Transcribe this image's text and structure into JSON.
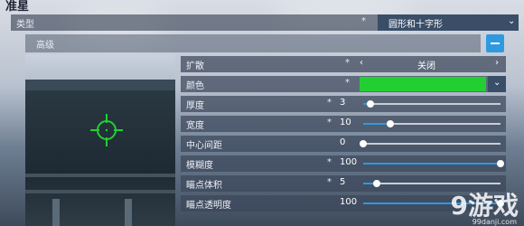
{
  "page": {
    "title": "准星"
  },
  "type_row": {
    "label": "类型",
    "star": "*",
    "value": "圆形和十字形"
  },
  "advanced": {
    "label": "高级",
    "toggle_icon": "minus-icon",
    "accent": "#2d9ae0"
  },
  "crosshair_color": "#22cf33",
  "settings": {
    "expand": {
      "label": "扩散",
      "star": "*",
      "value": "关闭"
    },
    "color": {
      "label": "颜色",
      "star": "*",
      "swatch": "#22cf33"
    },
    "thickness": {
      "label": "厚度",
      "star": "*",
      "value": "3",
      "fraction": 0.05
    },
    "width": {
      "label": "宽度",
      "star": "*",
      "value": "10",
      "fraction": 0.2
    },
    "center_gap": {
      "label": "中心间距",
      "value": "0",
      "fraction": 0.0
    },
    "blur": {
      "label": "模糊度",
      "star": "*",
      "value": "100",
      "fraction": 1.0
    },
    "dot_size": {
      "label": "瞄点体积",
      "star": "*",
      "value": "5",
      "fraction": 0.1
    },
    "dot_opacity": {
      "label": "瞄点透明度",
      "value": "100",
      "fraction": 1.0
    }
  },
  "watermark": {
    "text": "9游戏",
    "sub": "99danji.com"
  }
}
